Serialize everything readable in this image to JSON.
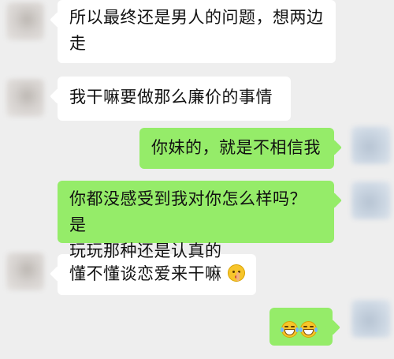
{
  "messages": [
    {
      "side": "in",
      "text": "所以最终还是男人的问题，想两边走"
    },
    {
      "side": "in",
      "text": "我干嘛要做那么廉价的事情"
    },
    {
      "side": "out",
      "text": "你妹的，就是不相信我"
    },
    {
      "side": "out",
      "text": "你都没感受到我对你怎么样吗？是玩玩那种还是认真的"
    },
    {
      "side": "in",
      "text": "懂不懂谈恋爱来干嘛",
      "emoji": "shush-face-icon"
    },
    {
      "side": "out",
      "text": "",
      "emoji": "grin-tears-icon x2"
    }
  ],
  "msg1": {
    "line1": "所以最终还是男人的问题，想两边",
    "line2": "走"
  },
  "msg2": {
    "text": "我干嘛要做那么廉价的事情"
  },
  "msg3": {
    "text": "你妹的，就是不相信我"
  },
  "msg4": {
    "line1": "你都没感受到我对你怎么样吗？是",
    "line2": "玩玩那种还是认真的"
  },
  "msg5": {
    "text": "懂不懂谈恋爱来干嘛"
  },
  "colors": {
    "incoming_bubble": "#ffffff",
    "outgoing_bubble": "#95ec69",
    "background": "#eeeeee"
  }
}
